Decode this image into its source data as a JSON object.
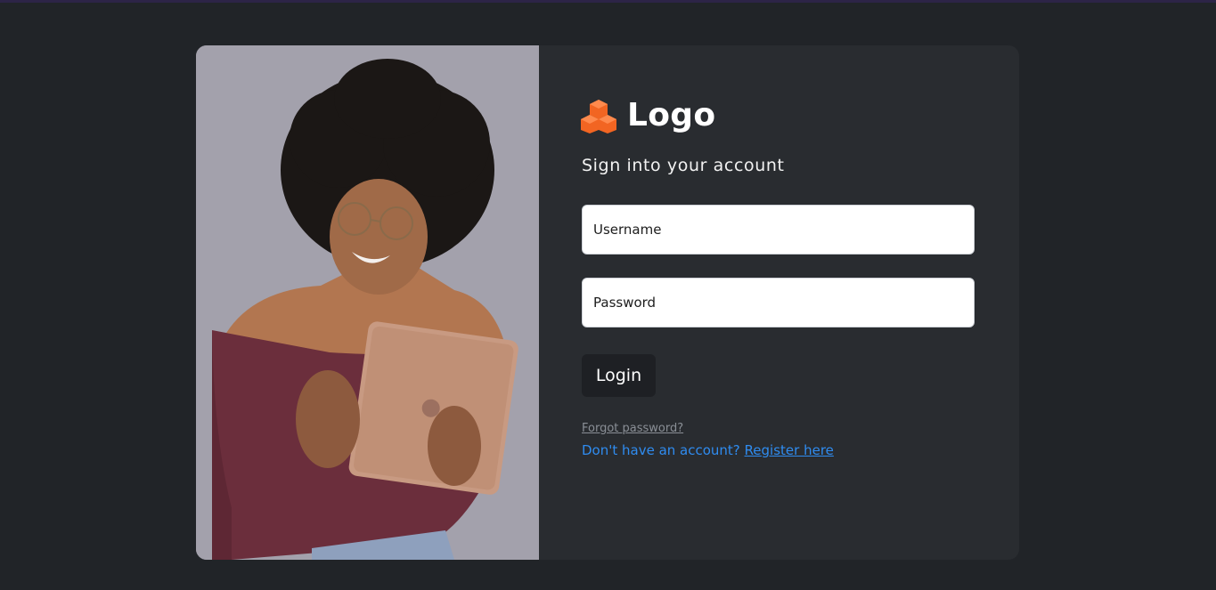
{
  "brand": {
    "name": "Logo",
    "icon": "cubes-icon",
    "accent_color": "#f26522"
  },
  "form": {
    "subtitle": "Sign into your account",
    "username_placeholder": "Username",
    "password_placeholder": "Password",
    "login_label": "Login",
    "forgot_password_label": "Forgot password?",
    "register_prompt": "Don't have an account?",
    "register_link_label": "Register here"
  },
  "colors": {
    "page_background": "#212428",
    "card_background": "#292c30",
    "button_background": "#1e2024",
    "link_color": "#2f8cf0"
  }
}
